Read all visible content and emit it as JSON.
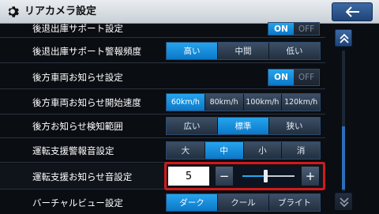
{
  "header": {
    "title": "リアカメラ設定",
    "back_icon": "left-arrow-icon",
    "settings_icon": "gear-icon"
  },
  "rows": [
    {
      "label": "後退出庫サポート設定",
      "control": "toggle",
      "on": "ON",
      "off": "OFF",
      "value": "ON"
    },
    {
      "label": "後退出庫サポート警報頻度",
      "control": "segment",
      "options": [
        "高い",
        "中間",
        "低い"
      ],
      "selected": "高い"
    },
    {
      "label": "後方車両お知らせ設定",
      "control": "toggle",
      "on": "ON",
      "off": "OFF",
      "value": "ON"
    },
    {
      "label": "後方車両お知らせ開始速度",
      "control": "segment",
      "options": [
        "60km/h",
        "80km/h",
        "100km/h",
        "120km/h"
      ],
      "selected": "60km/h"
    },
    {
      "label": "後方お知らせ検知範囲",
      "control": "segment",
      "options": [
        "広い",
        "標準",
        "狭い"
      ],
      "selected": "標準"
    },
    {
      "label": "運転支援警報音設定",
      "control": "segment",
      "options": [
        "大",
        "中",
        "小",
        "消"
      ],
      "selected": "中"
    },
    {
      "label": "運転支援お知らせ音設定",
      "control": "volume",
      "value": "5",
      "minus": "−",
      "plus": "+",
      "level": 0.4
    },
    {
      "label": "バーチャルビュー設定",
      "control": "segment",
      "options": [
        "ダーク",
        "クール",
        "ブライト"
      ],
      "selected": "ダーク"
    }
  ],
  "colors": {
    "accent": "#1a8fe0",
    "highlight_frame": "#d11a1a",
    "header_bg": "#dfe4e9"
  }
}
